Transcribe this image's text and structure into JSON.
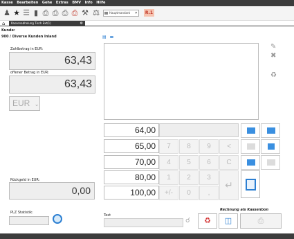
{
  "menu": [
    "Kasse",
    "Bearbeiten",
    "Gehe",
    "Extras",
    "BMV",
    "Info",
    "Hilfe"
  ],
  "toolbar": {
    "combo_value": "Hauptmandant",
    "red_badge": "R.1"
  },
  "tab": {
    "label": "Kassenabholung Tisch Ext(1)"
  },
  "customer": {
    "label": "Kunde:",
    "value": "900 / Diverse Kunden Inland"
  },
  "payment": {
    "zahlbetrag_label": "Zahlbetrag in EUR:",
    "zahlbetrag_value": "63,43",
    "offen_label": "offener Betrag in EUR:",
    "offen_value": "63,43",
    "currency": "EUR",
    "currency_arrow": "⌄"
  },
  "presets": [
    "64,00",
    "65,00",
    "70,00",
    "80,00",
    "100,00"
  ],
  "keypad": [
    "7",
    "8",
    "9",
    "<",
    "4",
    "5",
    "6",
    "C",
    "1",
    "2",
    "3",
    "↵",
    "+/-",
    "0",
    ","
  ],
  "change": {
    "label": "Rückgeld in EUR:",
    "value": "0,00"
  },
  "plz": {
    "label": "PLZ Statistik:"
  },
  "text_field": {
    "label": "Text"
  },
  "receipt": {
    "label": "Rechnung als Kassenbon"
  },
  "colors": {
    "accent": "#2c7fd2",
    "dark": "#3c3c3c",
    "danger": "#d32f2f"
  }
}
